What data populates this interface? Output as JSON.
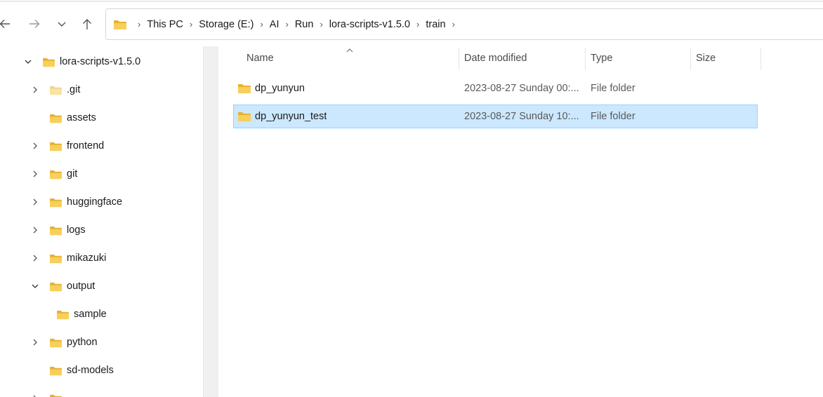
{
  "colors": {
    "folder": "#f2c94c",
    "folder_dark": "#e6b12e",
    "selection_bg": "#cce8ff",
    "selection_border": "#99d1ff"
  },
  "nav": {
    "back_icon": "arrow-left-icon",
    "forward_icon": "arrow-right-icon",
    "recent_icon": "chevron-down-icon",
    "up_icon": "arrow-up-icon"
  },
  "breadcrumb": [
    "This PC",
    "Storage (E:)",
    "AI",
    "Run",
    "lora-scripts-v1.5.0",
    "train"
  ],
  "sidebar": {
    "root": "lora-scripts-v1.5.0",
    "items": [
      {
        "label": ".git",
        "expandable": true
      },
      {
        "label": "assets",
        "expandable": false
      },
      {
        "label": "frontend",
        "expandable": true
      },
      {
        "label": "git",
        "expandable": true
      },
      {
        "label": "huggingface",
        "expandable": true
      },
      {
        "label": "logs",
        "expandable": true
      },
      {
        "label": "mikazuki",
        "expandable": true
      },
      {
        "label": "output",
        "expandable": true,
        "expanded": true
      },
      {
        "label": "sample",
        "expandable": false,
        "child": true
      },
      {
        "label": "python",
        "expandable": true
      },
      {
        "label": "sd-models",
        "expandable": false
      }
    ]
  },
  "columns": {
    "name": "Name",
    "date": "Date modified",
    "type": "Type",
    "size": "Size"
  },
  "files": [
    {
      "name": "dp_yunyun",
      "date": "2023-08-27 Sunday 00:...",
      "type": "File folder",
      "selected": false
    },
    {
      "name": "dp_yunyun_test",
      "date": "2023-08-27 Sunday 10:...",
      "type": "File folder",
      "selected": true
    }
  ]
}
